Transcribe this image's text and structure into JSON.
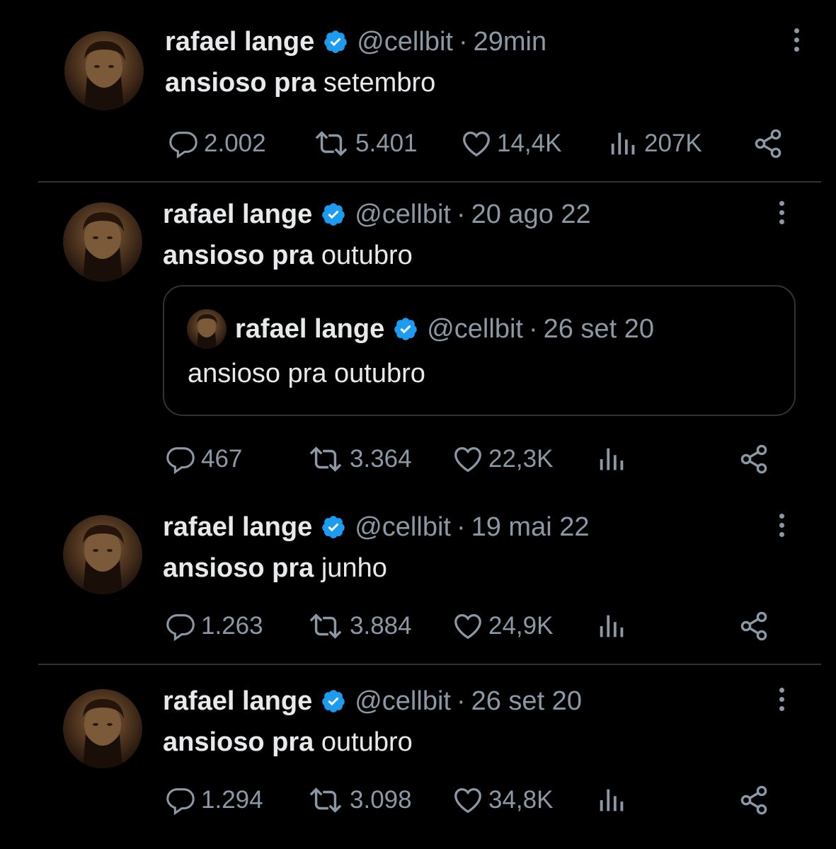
{
  "colors": {
    "background": "#000000",
    "text_primary": "#e7e9ea",
    "text_secondary": "#8b98a5",
    "verified_blue": "#1d9bf0",
    "divider": "#2f3336"
  },
  "icons": {
    "reply": "speech-bubble-icon",
    "retweet": "retweet-arrows-icon",
    "like": "heart-icon",
    "views": "bar-chart-icon",
    "share": "share-nodes-icon",
    "more": "vertical-ellipsis-icon",
    "verified": "verified-badge-icon"
  },
  "tweets": [
    {
      "name": "rafael lange",
      "handle": "@cellbit",
      "dot": "·",
      "time": "29min",
      "text_bold": "ansioso pra",
      "text_rest": " setembro",
      "replies": "2.002",
      "retweets": "5.401",
      "likes": "14,4K",
      "views": "207K"
    },
    {
      "name": "rafael lange",
      "handle": "@cellbit",
      "dot": "·",
      "time": "20 ago 22",
      "text_bold": "ansioso pra",
      "text_rest": " outubro",
      "quote": {
        "name": "rafael lange",
        "handle": "@cellbit",
        "dot": "·",
        "time": "26 set 20",
        "text": "ansioso pra outubro"
      },
      "replies": "467",
      "retweets": "3.364",
      "likes": "22,3K",
      "views": ""
    },
    {
      "name": "rafael lange",
      "handle": "@cellbit",
      "dot": "·",
      "time": "19 mai 22",
      "text_bold": "ansioso pra",
      "text_rest": " junho",
      "replies": "1.263",
      "retweets": "3.884",
      "likes": "24,9K",
      "views": ""
    },
    {
      "name": "rafael lange",
      "handle": "@cellbit",
      "dot": "·",
      "time": "26 set 20",
      "text_bold": "ansioso pra",
      "text_rest": " outubro",
      "replies": "1.294",
      "retweets": "3.098",
      "likes": "34,8K",
      "views": ""
    }
  ]
}
